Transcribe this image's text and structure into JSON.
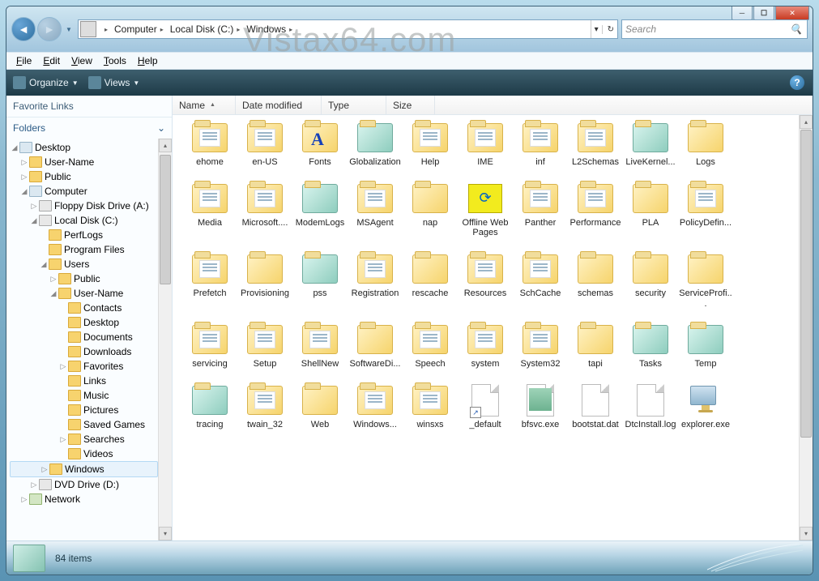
{
  "watermark": "Vistax64.com",
  "window": {
    "min": "—",
    "max": "❐",
    "close": "✕"
  },
  "address": {
    "crumbs": [
      "Computer",
      "Local Disk (C:)",
      "Windows"
    ]
  },
  "search": {
    "placeholder": "Search"
  },
  "menu": {
    "file": "File",
    "edit": "Edit",
    "view": "View",
    "tools": "Tools",
    "help": "Help"
  },
  "toolbar": {
    "organize": "Organize",
    "views": "Views"
  },
  "sidebar": {
    "favLinks": "Favorite Links",
    "folders": "Folders",
    "nodes": [
      {
        "ind": 0,
        "tog": "◢",
        "lbl": "Desktop",
        "cls": "comp"
      },
      {
        "ind": 1,
        "tog": "▷",
        "lbl": "User-Name",
        "cls": ""
      },
      {
        "ind": 1,
        "tog": "▷",
        "lbl": "Public",
        "cls": ""
      },
      {
        "ind": 1,
        "tog": "◢",
        "lbl": "Computer",
        "cls": "comp"
      },
      {
        "ind": 2,
        "tog": "▷",
        "lbl": "Floppy Disk Drive (A:)",
        "cls": "drive"
      },
      {
        "ind": 2,
        "tog": "◢",
        "lbl": "Local Disk (C:)",
        "cls": "drive"
      },
      {
        "ind": 3,
        "tog": "",
        "lbl": "PerfLogs",
        "cls": ""
      },
      {
        "ind": 3,
        "tog": "",
        "lbl": "Program Files",
        "cls": ""
      },
      {
        "ind": 3,
        "tog": "◢",
        "lbl": "Users",
        "cls": ""
      },
      {
        "ind": 4,
        "tog": "▷",
        "lbl": "Public",
        "cls": ""
      },
      {
        "ind": 4,
        "tog": "◢",
        "lbl": "User-Name",
        "cls": ""
      },
      {
        "ind": 5,
        "tog": "",
        "lbl": "Contacts",
        "cls": ""
      },
      {
        "ind": 5,
        "tog": "",
        "lbl": "Desktop",
        "cls": ""
      },
      {
        "ind": 5,
        "tog": "",
        "lbl": "Documents",
        "cls": ""
      },
      {
        "ind": 5,
        "tog": "",
        "lbl": "Downloads",
        "cls": ""
      },
      {
        "ind": 5,
        "tog": "▷",
        "lbl": "Favorites",
        "cls": ""
      },
      {
        "ind": 5,
        "tog": "",
        "lbl": "Links",
        "cls": ""
      },
      {
        "ind": 5,
        "tog": "",
        "lbl": "Music",
        "cls": ""
      },
      {
        "ind": 5,
        "tog": "",
        "lbl": "Pictures",
        "cls": ""
      },
      {
        "ind": 5,
        "tog": "",
        "lbl": "Saved Games",
        "cls": ""
      },
      {
        "ind": 5,
        "tog": "▷",
        "lbl": "Searches",
        "cls": ""
      },
      {
        "ind": 5,
        "tog": "",
        "lbl": "Videos",
        "cls": ""
      },
      {
        "ind": 3,
        "tog": "▷",
        "lbl": "Windows",
        "cls": "",
        "sel": true
      },
      {
        "ind": 2,
        "tog": "▷",
        "lbl": "DVD Drive (D:)",
        "cls": "drive"
      },
      {
        "ind": 1,
        "tog": "▷",
        "lbl": "Network",
        "cls": "net"
      }
    ]
  },
  "columns": {
    "name": "Name",
    "dateModified": "Date modified",
    "type": "Type",
    "size": "Size"
  },
  "rows": [
    [
      {
        "lbl": "ehome",
        "t": "f",
        "sub": "doc"
      },
      {
        "lbl": "en-US",
        "t": "f",
        "sub": "doc"
      },
      {
        "lbl": "Fonts",
        "t": "f",
        "font": true
      },
      {
        "lbl": "Globalization",
        "t": "ft",
        "sub": ""
      },
      {
        "lbl": "Help",
        "t": "f",
        "sub": "doc"
      },
      {
        "lbl": "IME",
        "t": "f",
        "sub": "doc"
      },
      {
        "lbl": "inf",
        "t": "f",
        "sub": "doc"
      },
      {
        "lbl": "L2Schemas",
        "t": "f",
        "sub": "doc"
      },
      {
        "lbl": "LiveKernel...",
        "t": "ft",
        "sub": ""
      },
      {
        "lbl": "Logs",
        "t": "f",
        "sub": ""
      }
    ],
    [
      {
        "lbl": "Media",
        "t": "f",
        "sub": "doc"
      },
      {
        "lbl": "Microsoft....",
        "t": "f",
        "sub": "doc"
      },
      {
        "lbl": "ModemLogs",
        "t": "ft"
      },
      {
        "lbl": "MSAgent",
        "t": "f",
        "sub": "doc"
      },
      {
        "lbl": "nap",
        "t": "f"
      },
      {
        "lbl": "Offline Web Pages",
        "t": "off"
      },
      {
        "lbl": "Panther",
        "t": "f",
        "sub": "doc"
      },
      {
        "lbl": "Performance",
        "t": "f",
        "sub": "doc"
      },
      {
        "lbl": "PLA",
        "t": "f"
      },
      {
        "lbl": "PolicyDefin...",
        "t": "f",
        "sub": "doc"
      }
    ],
    [
      {
        "lbl": "Prefetch",
        "t": "f",
        "sub": "doc"
      },
      {
        "lbl": "Provisioning",
        "t": "f"
      },
      {
        "lbl": "pss",
        "t": "ft"
      },
      {
        "lbl": "Registration",
        "t": "f",
        "sub": "doc"
      },
      {
        "lbl": "rescache",
        "t": "f"
      },
      {
        "lbl": "Resources",
        "t": "f",
        "sub": "doc"
      },
      {
        "lbl": "SchCache",
        "t": "f",
        "sub": "doc"
      },
      {
        "lbl": "schemas",
        "t": "f"
      },
      {
        "lbl": "security",
        "t": "f"
      },
      {
        "lbl": "ServiceProfi...",
        "t": "f"
      }
    ],
    [
      {
        "lbl": "servicing",
        "t": "f",
        "sub": "doc"
      },
      {
        "lbl": "Setup",
        "t": "f",
        "sub": "doc"
      },
      {
        "lbl": "ShellNew",
        "t": "f",
        "sub": "doc"
      },
      {
        "lbl": "SoftwareDi...",
        "t": "f"
      },
      {
        "lbl": "Speech",
        "t": "f",
        "sub": "doc"
      },
      {
        "lbl": "system",
        "t": "f",
        "sub": "doc"
      },
      {
        "lbl": "System32",
        "t": "f",
        "sub": "doc"
      },
      {
        "lbl": "tapi",
        "t": "f"
      },
      {
        "lbl": "Tasks",
        "t": "ft"
      },
      {
        "lbl": "Temp",
        "t": "ft"
      }
    ],
    [
      {
        "lbl": "tracing",
        "t": "ft"
      },
      {
        "lbl": "twain_32",
        "t": "f",
        "sub": "doc"
      },
      {
        "lbl": "Web",
        "t": "f"
      },
      {
        "lbl": "Windows...",
        "t": "f",
        "sub": "doc"
      },
      {
        "lbl": "winsxs",
        "t": "f",
        "sub": "doc"
      },
      {
        "lbl": "_default",
        "t": "file",
        "link": true
      },
      {
        "lbl": "bfsvc.exe",
        "t": "file",
        "img": true
      },
      {
        "lbl": "bootstat.dat",
        "t": "file"
      },
      {
        "lbl": "DtcInstall.log",
        "t": "file"
      },
      {
        "lbl": "explorer.exe",
        "t": "exe"
      }
    ]
  ],
  "status": {
    "count": "84 items"
  }
}
